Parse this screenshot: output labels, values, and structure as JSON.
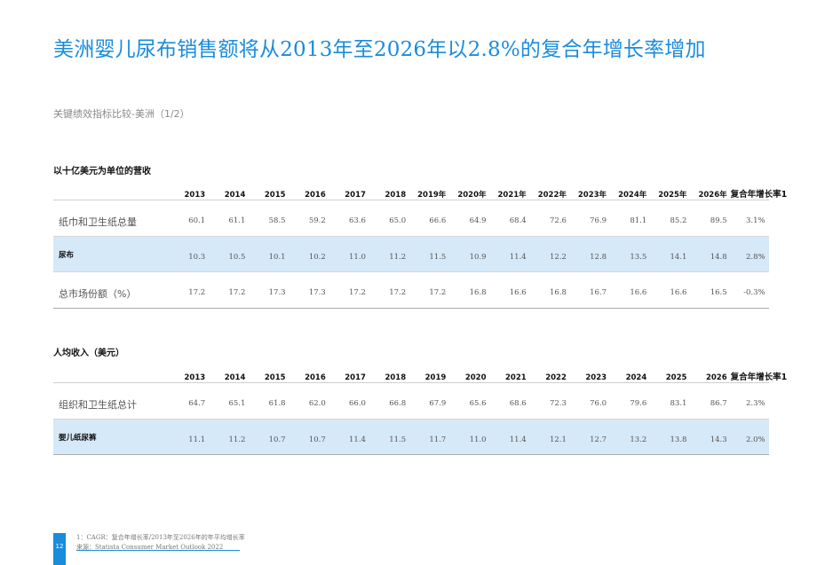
{
  "title": "美洲婴儿尿布销售额将从2013年至2026年以2.8%的复合年增长率增加",
  "subtitle": "关键绩效指标比较-美洲（1/2）",
  "section1": {
    "label": "以十亿美元为单位的营收",
    "years": [
      "2013",
      "2014",
      "2015",
      "2016",
      "2017",
      "2018",
      "2019年",
      "2020年",
      "2021年",
      "2022年",
      "2023年",
      "2024年",
      "2025年",
      "2026年"
    ],
    "cagr_header": "复合年增长率1",
    "rows": [
      {
        "label": "纸巾和卫生纸总量",
        "values": [
          "60.1",
          "61.1",
          "58.5",
          "59.2",
          "63.6",
          "65.0",
          "66.6",
          "64.9",
          "68.4",
          "72.6",
          "76.9",
          "81.1",
          "85.2",
          "89.5"
        ],
        "cagr": "3.1%"
      },
      {
        "label": "尿布",
        "values": [
          "10.3",
          "10.5",
          "10.1",
          "10.2",
          "11.0",
          "11.2",
          "11.5",
          "10.9",
          "11.4",
          "12.2",
          "12.8",
          "13.5",
          "14.1",
          "14.8"
        ],
        "cagr": "2.8%"
      },
      {
        "label": "总市场份额（%）",
        "values": [
          "17.2",
          "17.2",
          "17.3",
          "17.3",
          "17.2",
          "17.2",
          "17.2",
          "16.8",
          "16.6",
          "16.8",
          "16.7",
          "16.6",
          "16.6",
          "16.5"
        ],
        "cagr": "-0.3%"
      }
    ]
  },
  "section2": {
    "label": "人均收入（美元）",
    "years": [
      "2013",
      "2014",
      "2015",
      "2016",
      "2017",
      "2018",
      "2019",
      "2020",
      "2021",
      "2022",
      "2023",
      "2024",
      "2025",
      "2026"
    ],
    "cagr_header": "复合年增长率1",
    "rows": [
      {
        "label": "组织和卫生纸总计",
        "values": [
          "64.7",
          "65.1",
          "61.8",
          "62.0",
          "66.0",
          "66.8",
          "67.9",
          "65.6",
          "68.6",
          "72.3",
          "76.0",
          "79.6",
          "83.1",
          "86.7"
        ],
        "cagr": "2.3%"
      },
      {
        "label": "婴儿纸尿裤",
        "values": [
          "11.1",
          "11.2",
          "10.7",
          "10.7",
          "11.4",
          "11.5",
          "11.7",
          "11.0",
          "11.4",
          "12.1",
          "12.7",
          "13.2",
          "13.8",
          "14.3"
        ],
        "cagr": "2.0%"
      }
    ]
  },
  "footer": {
    "page_number": "12",
    "footnote": "1：CAGR：复合年增长率/2013年至2026年的年平均增长率",
    "source": "来源：Statista Consumer Market Outlook 2022"
  },
  "colors": {
    "accent": "#1a8cdc",
    "highlight_row": "#d6e9f8"
  }
}
